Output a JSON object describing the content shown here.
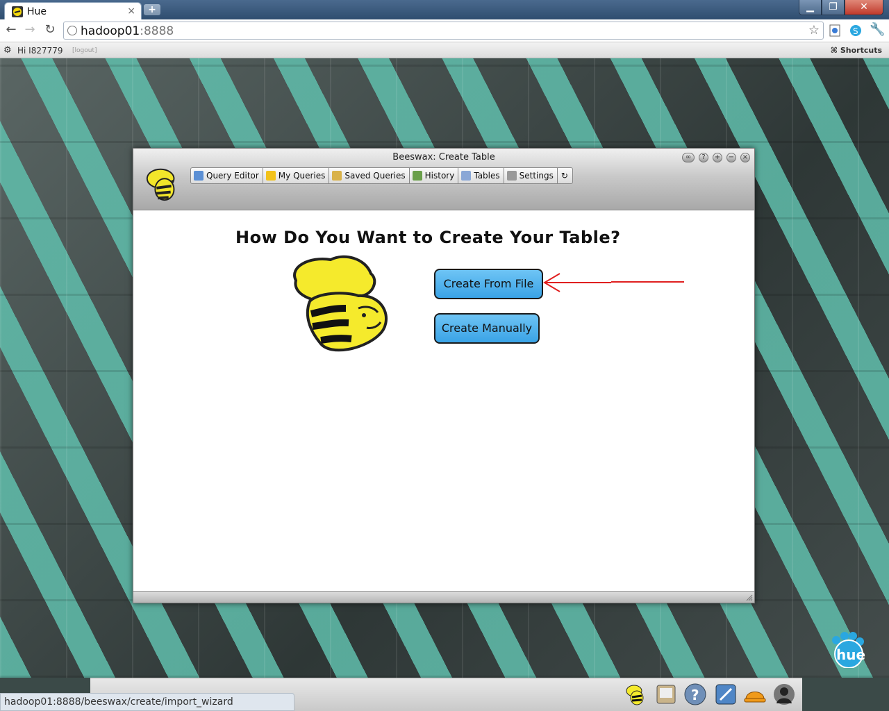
{
  "browser": {
    "tab_title": "Hue",
    "tab_close": "×",
    "new_tab": "+",
    "address_host": "hadoop01",
    "address_port": ":8888",
    "status_url": "hadoop01:8888/beeswax/create/import_wizard"
  },
  "hue_bar": {
    "greeting": "Hi I827779",
    "logout": "[logout]",
    "shortcuts": "Shortcuts"
  },
  "window": {
    "title": "Beeswax: Create Table",
    "nav": [
      {
        "label": "Query Editor",
        "icon": "query-editor-icon"
      },
      {
        "label": "My Queries",
        "icon": "star-icon"
      },
      {
        "label": "Saved Queries",
        "icon": "saved-queries-icon"
      },
      {
        "label": "History",
        "icon": "clock-icon"
      },
      {
        "label": "Tables",
        "icon": "tables-icon"
      },
      {
        "label": "Settings",
        "icon": "gear-icon"
      }
    ],
    "heading": "How Do You Want to Create Your Table?",
    "btn_file": "Create From File",
    "btn_manual": "Create Manually"
  },
  "colors": {
    "button_blue": "#3aa3e6",
    "annotation_arrow": "#e02020"
  }
}
